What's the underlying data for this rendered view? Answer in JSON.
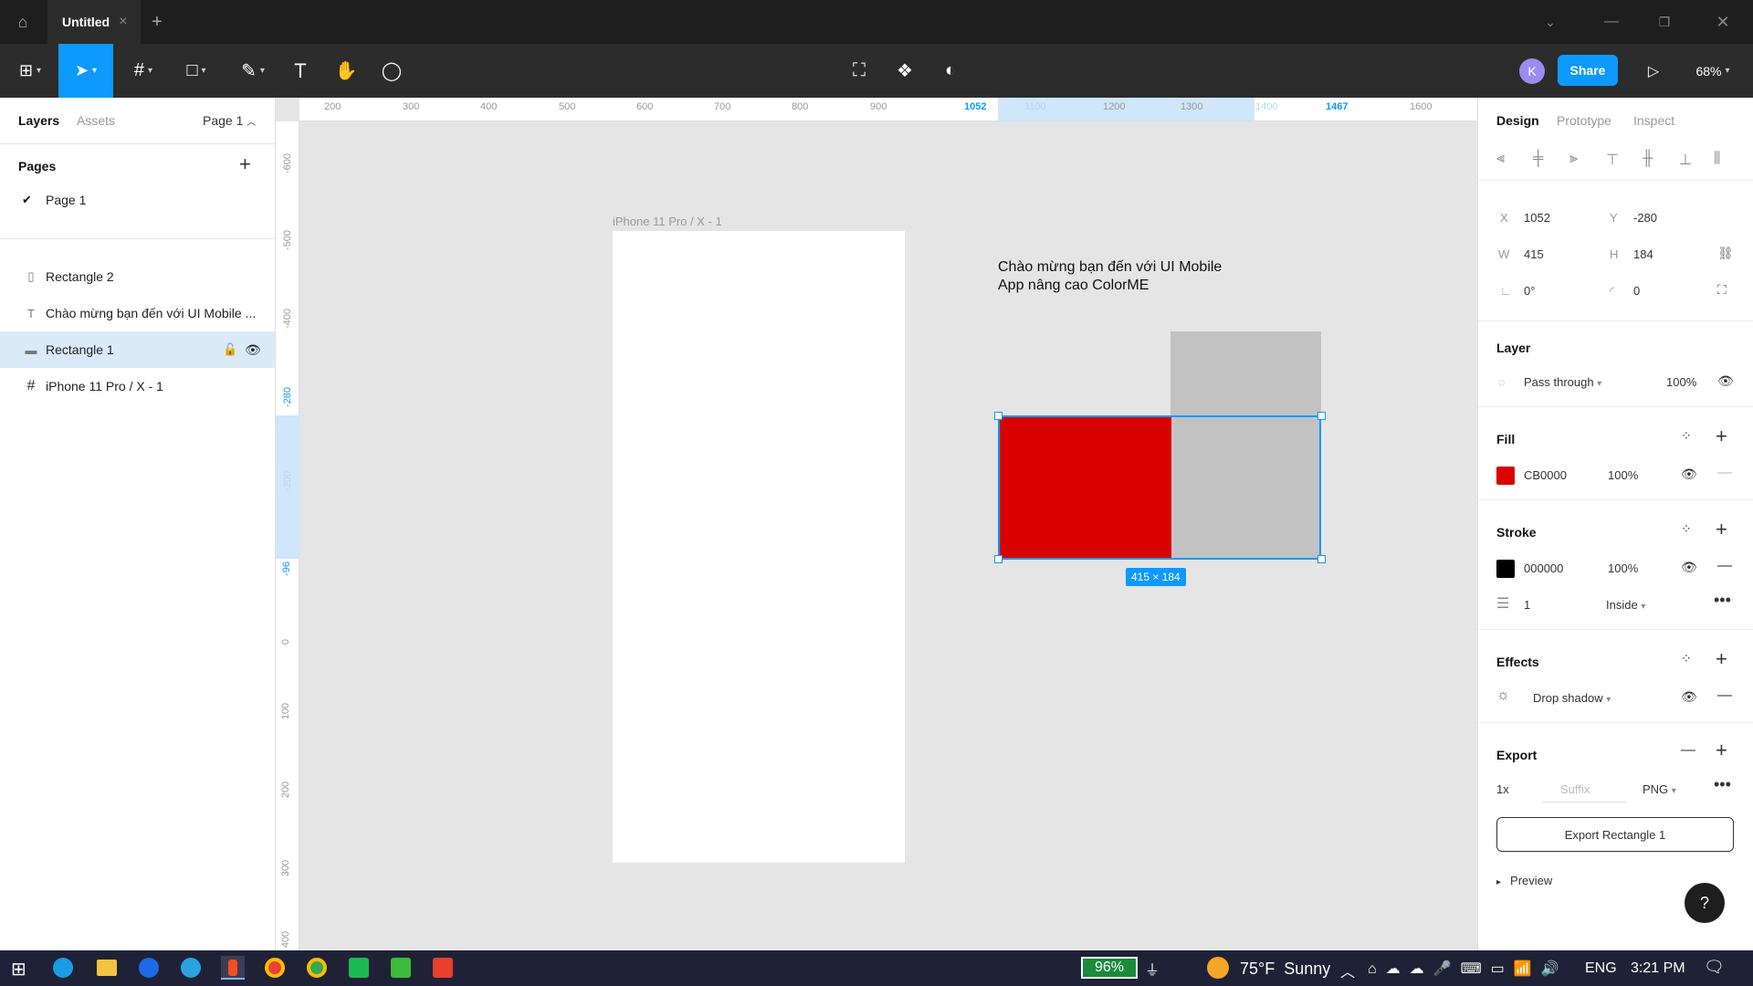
{
  "window": {
    "tab_title": "Untitled",
    "new_tab": "+",
    "close_tab": "×"
  },
  "toolbar": {
    "avatar_initial": "K",
    "share_label": "Share",
    "zoom": "68%"
  },
  "left_panel": {
    "tabs": [
      "Layers",
      "Assets"
    ],
    "page_selector": "Page 1",
    "pages_title": "Pages",
    "pages": [
      "Page 1"
    ],
    "layers": [
      {
        "name": "Rectangle 2",
        "icon": "rectangle-outline-icon"
      },
      {
        "name": "Chào mừng bạn đến với UI Mobile ...",
        "icon": "text-icon"
      },
      {
        "name": "Rectangle 1",
        "icon": "rectangle-icon",
        "selected": true
      },
      {
        "name": "iPhone 11 Pro / X - 1",
        "icon": "frame-icon"
      }
    ]
  },
  "canvas": {
    "frame_label": "iPhone 11 Pro / X - 1",
    "text_line1": "Chào mừng bạn đến với UI Mobile",
    "text_line2": "App nâng cao ColorME",
    "size_badge": "415 × 184",
    "ruler_h": [
      "200",
      "300",
      "400",
      "500",
      "600",
      "700",
      "800",
      "900",
      "1052",
      "1100",
      "1200",
      "1300",
      "1400",
      "1467",
      "1600"
    ],
    "ruler_v": [
      "-600",
      "-500",
      "-400",
      "-280",
      "-200",
      "-96",
      "0",
      "100",
      "200",
      "300",
      "400"
    ]
  },
  "right_panel": {
    "tabs": [
      "Design",
      "Prototype",
      "Inspect"
    ],
    "x_label": "X",
    "x_value": "1052",
    "y_label": "Y",
    "y_value": "-280",
    "w_label": "W",
    "w_value": "415",
    "h_label": "H",
    "h_value": "184",
    "rotation": "0°",
    "radius": "0",
    "layer_title": "Layer",
    "blend_mode": "Pass through",
    "layer_opacity": "100%",
    "fill_title": "Fill",
    "fill_hex": "CB0000",
    "fill_opacity": "100%",
    "fill_color": "#cb0000",
    "stroke_title": "Stroke",
    "stroke_hex": "000000",
    "stroke_opacity": "100%",
    "stroke_color": "#000000",
    "stroke_weight": "1",
    "stroke_position": "Inside",
    "effects_title": "Effects",
    "effect_type": "Drop shadow",
    "export_title": "Export",
    "export_scale": "1x",
    "export_suffix_placeholder": "Suffix",
    "export_format": "PNG",
    "export_button": "Export Rectangle 1",
    "preview_label": "Preview",
    "help": "?"
  },
  "taskbar": {
    "battery": "96%",
    "weather": "75°F  Sunny",
    "language": "ENG",
    "time": "3:21 PM"
  },
  "colors": {
    "accent": "#0d99ff",
    "share": "#0d99ff",
    "avatar": "#9b8cf0",
    "rect_red": "#d90000",
    "rect_gray": "#c2c2c2"
  }
}
